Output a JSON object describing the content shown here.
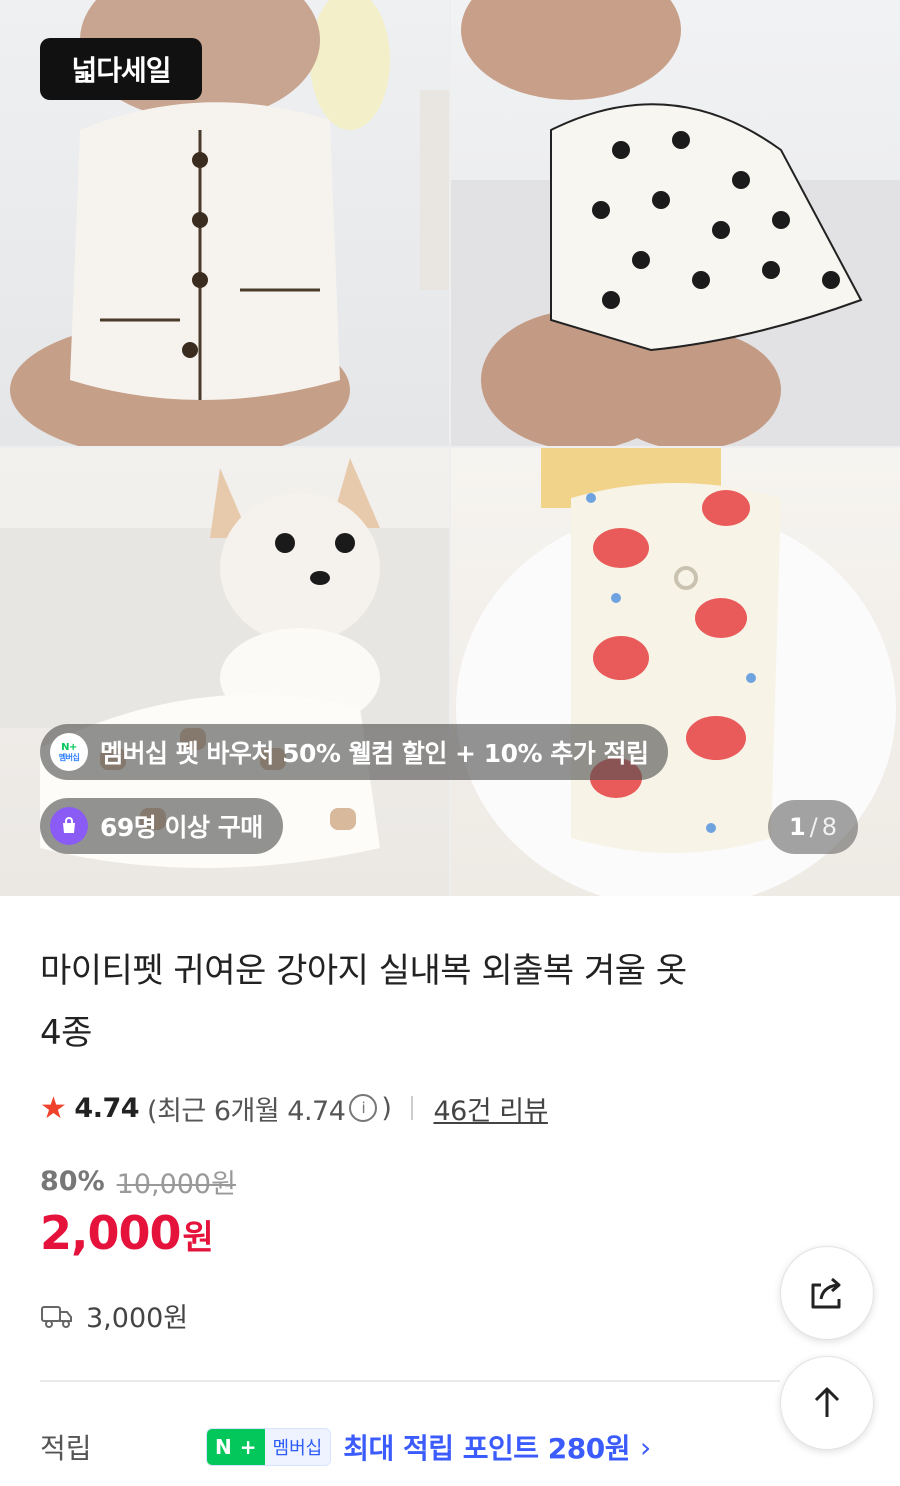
{
  "gallery": {
    "sale_badge": "넓다세일",
    "membership_pill": "멤버십 펫 바우처 50% 웰컴 할인 + 10% 추가 적립",
    "membership_icon_top": "N+",
    "membership_icon_bottom": "멤버십",
    "purchase_pill": "69명 이상 구매",
    "counter_current": "1",
    "counter_sep": "/",
    "counter_total": "8"
  },
  "product": {
    "title_line1": "마이티펫 귀여운 강아지 실내복 외출복 겨울 옷",
    "title_line2": "4종",
    "rating": "4.74",
    "recent_prefix": "(최근 6개월 4.74",
    "recent_suffix": ")",
    "reviews": "46건 리뷰",
    "discount_pct": "80%",
    "original_price": "10,000원",
    "price": "2,000",
    "price_unit": "원",
    "shipping": "3,000원"
  },
  "points": {
    "label": "적립",
    "chip_n": "N",
    "chip_plus": "+",
    "chip_membership": "멤버십",
    "text": "최대 적립 포인트 280원",
    "chevron": "›"
  },
  "icons": {
    "star": "star-icon",
    "info": "info-icon",
    "truck": "truck-icon",
    "share": "share-icon",
    "arrow_up": "arrow-up-icon"
  },
  "colors": {
    "price_red": "#e5123c",
    "star_red": "#f0412a",
    "point_blue": "#3b5bfd",
    "naver_green": "#03c75a",
    "bag_purple": "#8a5cf5"
  }
}
